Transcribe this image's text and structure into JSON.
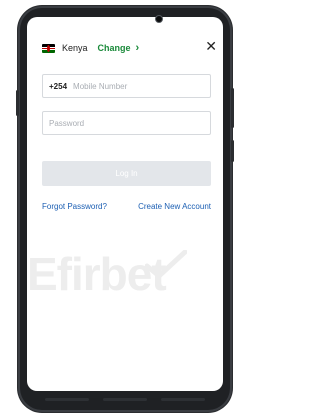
{
  "header": {
    "country": "Kenya",
    "change_label": "Change",
    "chevron_icon": "chevron-right-icon",
    "close_icon": "close-icon"
  },
  "form": {
    "country_code": "+254",
    "mobile_placeholder": "Mobile Number",
    "password_placeholder": "Password",
    "login_label": "Log In"
  },
  "links": {
    "forgot_password": "Forgot Password?",
    "create_account": "Create New Account"
  },
  "watermark": "Efirbet",
  "colors": {
    "accent_green": "#1a8a3a",
    "link_blue": "#1c5fb3",
    "button_disabled": "#e3e6ea"
  }
}
